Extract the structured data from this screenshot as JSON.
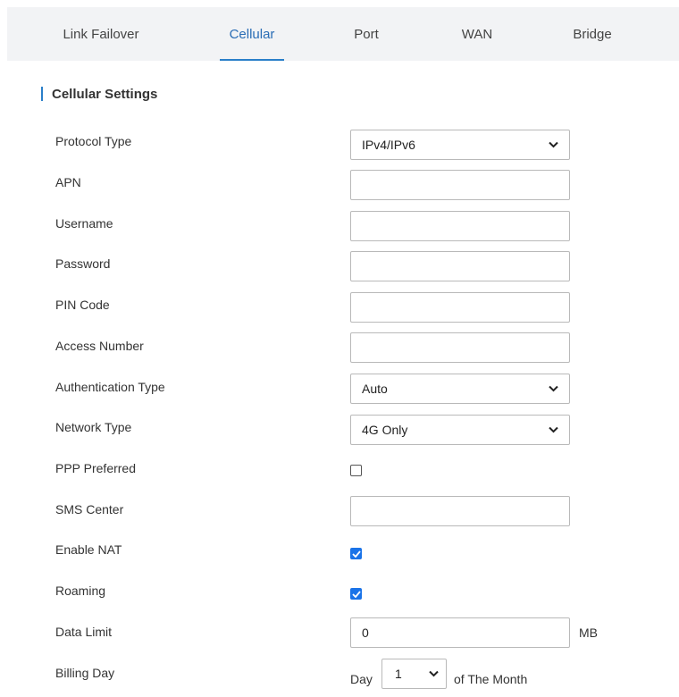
{
  "tabs": [
    {
      "label": "Link Failover",
      "active": false
    },
    {
      "label": "Cellular",
      "active": true
    },
    {
      "label": "Port",
      "active": false
    },
    {
      "label": "WAN",
      "active": false
    },
    {
      "label": "Bridge",
      "active": false
    }
  ],
  "section_title": "Cellular Settings",
  "accent_color": "#2a7fc9",
  "fields": {
    "protocol_type": {
      "label": "Protocol Type",
      "value": "IPv4/IPv6"
    },
    "apn": {
      "label": "APN",
      "value": ""
    },
    "username": {
      "label": "Username",
      "value": ""
    },
    "password": {
      "label": "Password",
      "value": ""
    },
    "pin_code": {
      "label": "PIN Code",
      "value": ""
    },
    "access_number": {
      "label": "Access Number",
      "value": ""
    },
    "authentication_type": {
      "label": "Authentication Type",
      "value": "Auto"
    },
    "network_type": {
      "label": "Network Type",
      "value": "4G Only"
    },
    "ppp_preferred": {
      "label": "PPP Preferred",
      "checked": false
    },
    "sms_center": {
      "label": "SMS Center",
      "value": ""
    },
    "enable_nat": {
      "label": "Enable NAT",
      "checked": true
    },
    "roaming": {
      "label": "Roaming",
      "checked": true
    },
    "data_limit": {
      "label": "Data Limit",
      "value": "0",
      "unit": "MB"
    },
    "billing_day": {
      "label": "Billing Day",
      "prefix": "Day",
      "value": "1",
      "suffix": "of The Month"
    }
  }
}
